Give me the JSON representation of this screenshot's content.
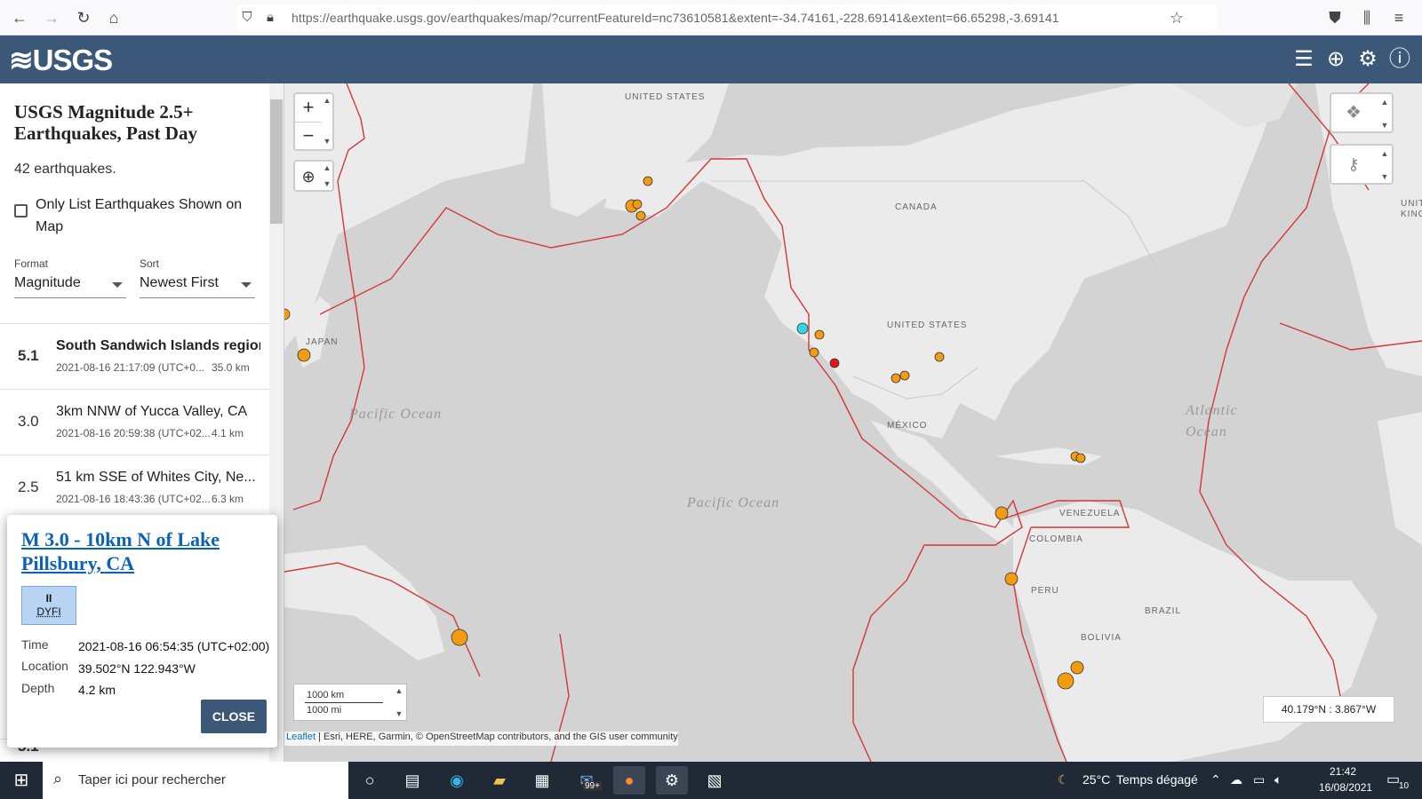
{
  "browser": {
    "url": "https://earthquake.usgs.gov/earthquakes/map/?currentFeatureId=nc73610581&extent=-34.74161,-228.69141&extent=66.65298,-3.69141",
    "icons": [
      "back-arrow-icon",
      "forward-arrow-icon",
      "reload-icon",
      "home-icon",
      "shield-icon",
      "lock-icon",
      "star-icon",
      "pocket-icon",
      "library-icon",
      "menu-icon"
    ]
  },
  "header": {
    "logo": "≋USGS",
    "icons": [
      "list-icon",
      "globe-icon",
      "gear-icon",
      "help-icon"
    ]
  },
  "sidebar": {
    "title": "USGS Magnitude 2.5+ Earthquakes, Past Day",
    "count": "42 earthquakes.",
    "only_list_label": "Only List Earthquakes Shown on Map",
    "format_label": "Format",
    "format_value": "Magnitude",
    "sort_label": "Sort",
    "sort_value": "Newest First",
    "earthquakes": [
      {
        "mag": "5.1",
        "place": "South Sandwich Islands region",
        "time": "2021-08-16 21:17:09 (UTC+0...",
        "depth": "35.0 km",
        "bold": true
      },
      {
        "mag": "3.0",
        "place": "3km NNW of Yucca Valley, CA",
        "time": "2021-08-16 20:59:38 (UTC+02...",
        "depth": "4.1 km",
        "bold": false
      },
      {
        "mag": "2.5",
        "place": "51 km SSE of Whites City, Ne...",
        "time": "2021-08-16 18:43:36 (UTC+02...",
        "depth": "6.3 km",
        "bold": false
      }
    ],
    "partial_row_mag": "5.1"
  },
  "popup": {
    "title": "M 3.0 - 10km N of Lake Pillsbury, CA",
    "dyfi_level": "II",
    "dyfi_label": "DYFI",
    "time_label": "Time",
    "time_value": "2021-08-16 06:54:35 (UTC+02:00)",
    "location_label": "Location",
    "location_value": "39.502°N 122.943°W",
    "depth_label": "Depth",
    "depth_value": "4.2 km",
    "close_label": "CLOSE"
  },
  "map": {
    "labels": {
      "us_top": "UNITED STATES",
      "canada": "CANADA",
      "us_mid": "UNITED STATES",
      "mexico": "MÉXICO",
      "japan": "JAPAN",
      "venezuela": "VENEZUELA",
      "colombia": "COLOMBIA",
      "peru": "PERU",
      "brazil": "BRAZIL",
      "bolivia": "BOLIVIA",
      "uk": "UNIT KING"
    },
    "oceans": {
      "pacific1": "Pacific Ocean",
      "pacific2": "Pacific Ocean",
      "atlantic": "Atlantic Ocean"
    },
    "zoom_in": "+",
    "zoom_out": "−",
    "scale_km": "1000 km",
    "scale_mi": "1000 mi",
    "coords": "40.179°N : 3.867°W",
    "attribution_link": "Leaflet",
    "attribution_text": " | Esri, HERE, Garmin, © OpenStreetMap contributors, and the GIS user community",
    "colors": {
      "orange": "#f39c12",
      "red": "#e2161b",
      "cyan": "#34d3e8",
      "plate": "#d23838",
      "land": "#ebebeb",
      "water": "#d3d3d3"
    }
  },
  "taskbar": {
    "search_placeholder": "Taper ici pour rechercher",
    "weather_temp": "25°C",
    "weather_text": "Temps dégagé",
    "time": "21:42",
    "date": "16/08/2021",
    "mail_badge": "99+",
    "notif_count": "10"
  }
}
